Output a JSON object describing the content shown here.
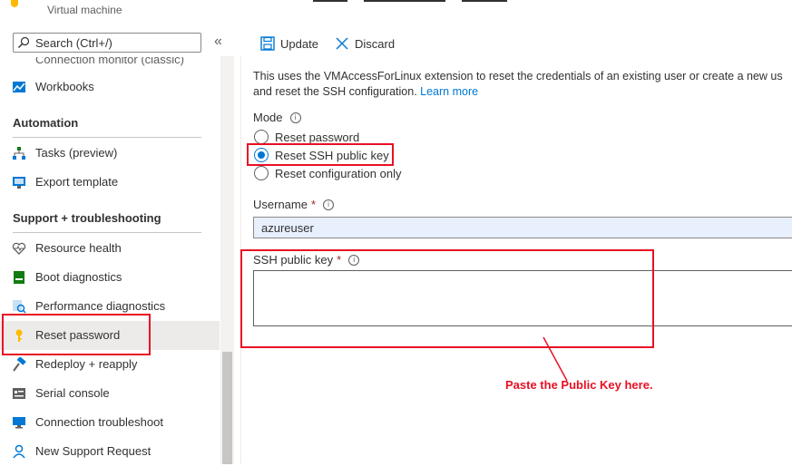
{
  "header": {
    "subtitle": "Virtual machine"
  },
  "sidebar": {
    "search_text": "Search (Ctrl+/)",
    "collapse_glyph": "«",
    "partial_item": "Connection monitor (classic)",
    "items_top": [
      {
        "label": "Workbooks",
        "icon": "workbooks-icon"
      }
    ],
    "section_automation": "Automation",
    "items_automation": [
      {
        "label": "Tasks (preview)",
        "icon": "tasks-icon"
      },
      {
        "label": "Export template",
        "icon": "export-template-icon"
      }
    ],
    "section_support": "Support + troubleshooting",
    "items_support": [
      {
        "label": "Resource health",
        "icon": "heart-icon"
      },
      {
        "label": "Boot diagnostics",
        "icon": "boot-diagnostics-icon"
      },
      {
        "label": "Performance diagnostics",
        "icon": "performance-diagnostics-icon"
      },
      {
        "label": "Reset password",
        "icon": "key-icon",
        "active": true
      },
      {
        "label": "Redeploy + reapply",
        "icon": "hammer-icon"
      },
      {
        "label": "Serial console",
        "icon": "serial-console-icon"
      },
      {
        "label": "Connection troubleshoot",
        "icon": "monitor-icon"
      },
      {
        "label": "New Support Request",
        "icon": "support-person-icon"
      }
    ]
  },
  "toolbar": {
    "update_label": "Update",
    "discard_label": "Discard"
  },
  "main": {
    "description": "This uses the VMAccessForLinux extension to reset the credentials of an existing user or create a new us",
    "description_line2": "and reset the SSH configuration.",
    "learn_more": "Learn more",
    "mode_label": "Mode",
    "mode_options": [
      "Reset password",
      "Reset SSH public key",
      "Reset configuration only"
    ],
    "mode_selected": "Reset SSH public key",
    "username_label": "Username",
    "username_value": "azureuser",
    "ssh_key_label": "SSH public key",
    "required_mark": "*",
    "info_glyph": "i",
    "ssh_key_value": ""
  },
  "annotation": {
    "callout_text": "Paste the Public Key here.",
    "color": "#e81123"
  },
  "colors": {
    "accent": "#0078d4",
    "required": "#a4262c",
    "active_bg": "#edebe9"
  }
}
